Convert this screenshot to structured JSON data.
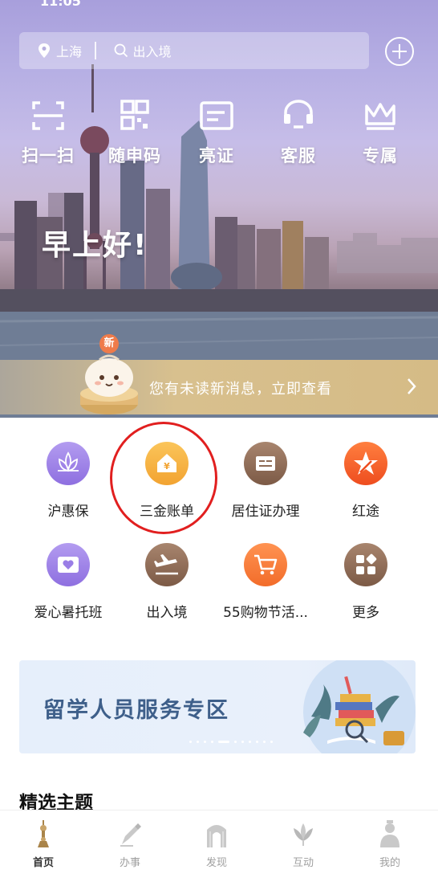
{
  "status": {
    "time": "11:05"
  },
  "search": {
    "location": "上海",
    "placeholder": "出入境"
  },
  "quick_actions": [
    {
      "label": "扫一扫",
      "icon": "scan-icon"
    },
    {
      "label": "随申码",
      "icon": "qr-code-icon"
    },
    {
      "label": "亮证",
      "icon": "id-card-icon"
    },
    {
      "label": "客服",
      "icon": "headset-icon"
    },
    {
      "label": "专属",
      "icon": "crown-icon"
    }
  ],
  "greeting": "早上好!",
  "message": {
    "badge": "新",
    "text": "您有未读新消息，立即查看"
  },
  "services": [
    {
      "label": "沪惠保",
      "icon": "lotus-icon",
      "color": "#9a7ee6"
    },
    {
      "label": "三金账单",
      "icon": "house-yen-icon",
      "color": "#f6b23c"
    },
    {
      "label": "居住证办理",
      "icon": "residence-card-icon",
      "color": "#8e6b55"
    },
    {
      "label": "红途",
      "icon": "red-star-icon",
      "color": "#f1582b"
    },
    {
      "label": "爱心暑托班",
      "icon": "heart-ticket-icon",
      "color": "#9a7ee6"
    },
    {
      "label": "出入境",
      "icon": "airplane-icon",
      "color": "#8e6b55"
    },
    {
      "label": "55购物节活...",
      "icon": "shopping-cart-icon",
      "color": "#f57b3a"
    },
    {
      "label": "更多",
      "icon": "more-grid-icon",
      "color": "#8e6b55"
    }
  ],
  "study_banner": {
    "title": "留学人员服务专区"
  },
  "section": {
    "title": "精选主题"
  },
  "tabs": [
    {
      "label": "首页",
      "icon": "home-tower-icon",
      "active": true
    },
    {
      "label": "办事",
      "icon": "pen-icon",
      "active": false
    },
    {
      "label": "发现",
      "icon": "arch-icon",
      "active": false
    },
    {
      "label": "互动",
      "icon": "magnolia-icon",
      "active": false
    },
    {
      "label": "我的",
      "icon": "person-icon",
      "active": false
    }
  ]
}
